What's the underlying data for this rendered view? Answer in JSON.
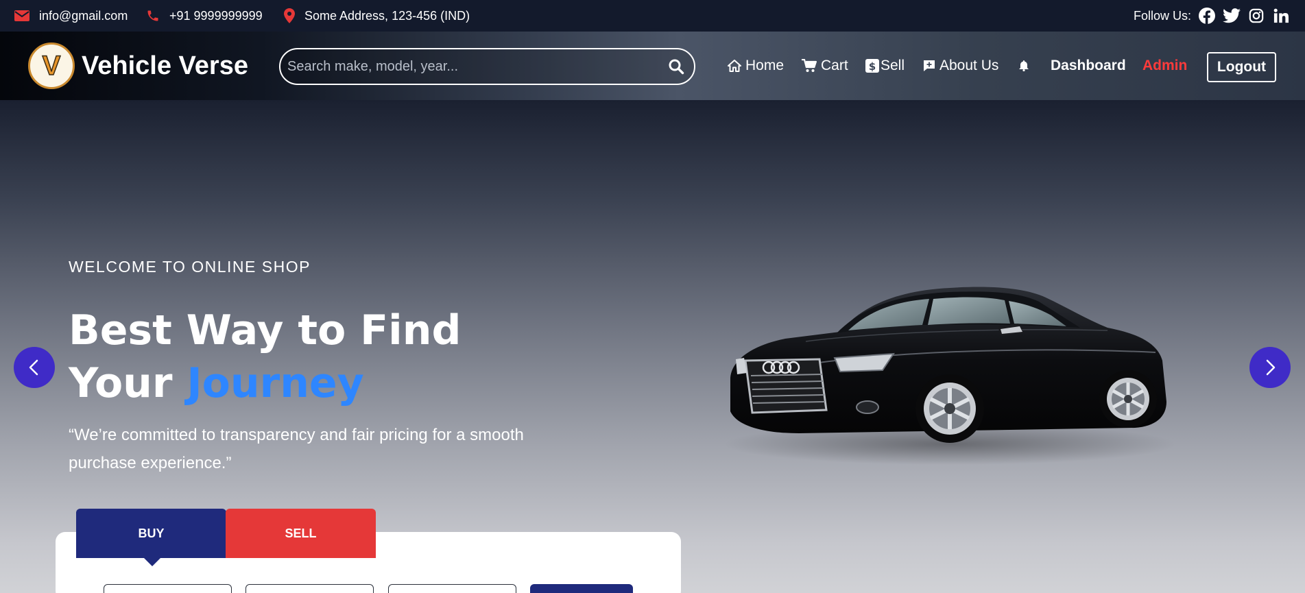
{
  "topbar": {
    "email": "info@gmail.com",
    "phone": "+91 9999999999",
    "address": "Some Address, 123-456 (IND)",
    "follow_label": "Follow Us:",
    "socials": [
      "facebook-icon",
      "twitter-icon",
      "instagram-icon",
      "linkedin-icon"
    ]
  },
  "navbar": {
    "logo_letter": "V",
    "brand": "Vehicle Verse",
    "search_placeholder": "Search make, model, year...",
    "links": {
      "home": "Home",
      "cart": "Cart",
      "sell": "Sell",
      "about": "About Us",
      "dashboard": "Dashboard",
      "admin": "Admin",
      "logout": "Logout"
    }
  },
  "hero": {
    "welcome": "WELCOME TO ONLINE SHOP",
    "headline_line1": "Best Way to Find",
    "headline_line2_prefix": "Your",
    "headline_accent": "Journey",
    "quote": "“We’re committed to transparency and fair pricing for a smooth purchase experience.”"
  },
  "tabs": {
    "buy": "BUY",
    "sell": "SELL"
  },
  "colors": {
    "accent_blue": "#2e86ff",
    "admin_red": "#ff3b3b",
    "buy_tab": "#1f2a7c",
    "sell_tab": "#e53838",
    "arrow_purple": "#3f2bc7"
  }
}
